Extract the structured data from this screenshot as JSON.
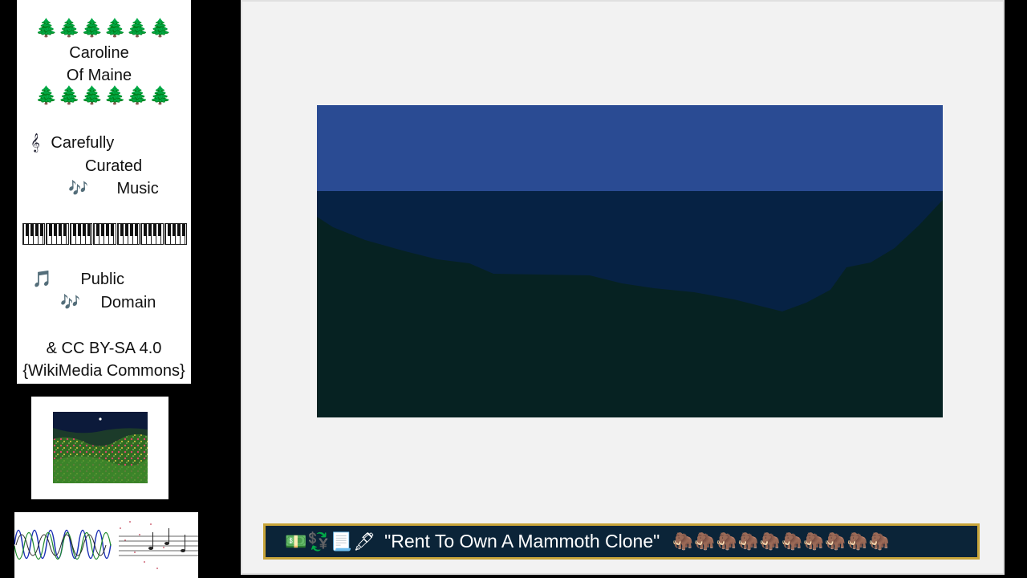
{
  "info_card": {
    "tree_row": "🌲🌲🌲🌲🌲🌲",
    "artist_line1": "Caroline",
    "artist_line2": "Of Maine",
    "treble_clef_icon": "𝄞",
    "line_carefully": "Carefully",
    "line_curated": "Curated",
    "notes_icon": "🎶",
    "line_music": "Music",
    "note_icon": "🎵",
    "line_public": "Public",
    "line_domain": "Domain",
    "license_line1": "&  CC BY-SA 4.0",
    "license_line2": "{WikiMedia Commons}"
  },
  "ticker": {
    "icons": "💵💱📃🖋",
    "title": "\"Rent To Own A Mammoth Clone\"",
    "mammoths": "🦣🦣🦣🦣🦣🦣🦣🦣🦣🦣"
  },
  "colors": {
    "sky": "#2a4b93",
    "night_band": "#062244",
    "ground": "#062222",
    "panel_bg": "#f2f2f2",
    "ticker_bg": "#0b2438",
    "ticker_border": "#c8a53a"
  }
}
